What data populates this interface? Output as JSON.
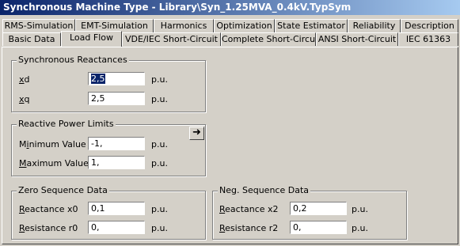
{
  "window": {
    "title": "Synchronous Machine Type - Library\\Syn_1.25MVA_0.4kV.TypSym"
  },
  "tabs_row1": [
    "RMS-Simulation",
    "EMT-Simulation",
    "Harmonics",
    "Optimization",
    "State Estimator",
    "Reliability",
    "Description"
  ],
  "tabs_row2": [
    "Basic Data",
    "Load Flow",
    "VDE/IEC Short-Circuit",
    "Complete Short-Circuit",
    "ANSI Short-Circuit",
    "IEC 61363"
  ],
  "active_tab": "Load Flow",
  "sync_reactances": {
    "title": "Synchronous Reactances",
    "xd": {
      "label_ul": "x",
      "label_rest": "d",
      "value": "2,5",
      "unit": "p.u."
    },
    "xq": {
      "label_ul": "x",
      "label_rest": "q",
      "value": "2,5",
      "unit": "p.u."
    }
  },
  "reactive_power_limits": {
    "title": "Reactive Power Limits",
    "arrow_icon": "right-arrow-icon",
    "min": {
      "label_pre": "M",
      "label_ul": "i",
      "label_rest": "nimum Value",
      "value": "-1,",
      "unit": "p.u."
    },
    "max": {
      "label_pre": "",
      "label_ul": "M",
      "label_rest": "aximum Value",
      "value": "1,",
      "unit": "p.u."
    }
  },
  "zero_sequence": {
    "title": "Zero Sequence Data",
    "reactance": {
      "label_ul": "R",
      "label_rest": "eactance x0",
      "value": "0,1",
      "unit": "p.u."
    },
    "resistance": {
      "label_ul": "R",
      "label_rest": "esistance r0",
      "value": "0,",
      "unit": "p.u."
    }
  },
  "neg_sequence": {
    "title": "Neg. Sequence Data",
    "reactance": {
      "label_ul": "R",
      "label_rest": "eactance x2",
      "value": "0,2",
      "unit": "p.u."
    },
    "resistance": {
      "label_ul": "R",
      "label_rest": "esistance r2",
      "value": "0,",
      "unit": "p.u."
    }
  }
}
